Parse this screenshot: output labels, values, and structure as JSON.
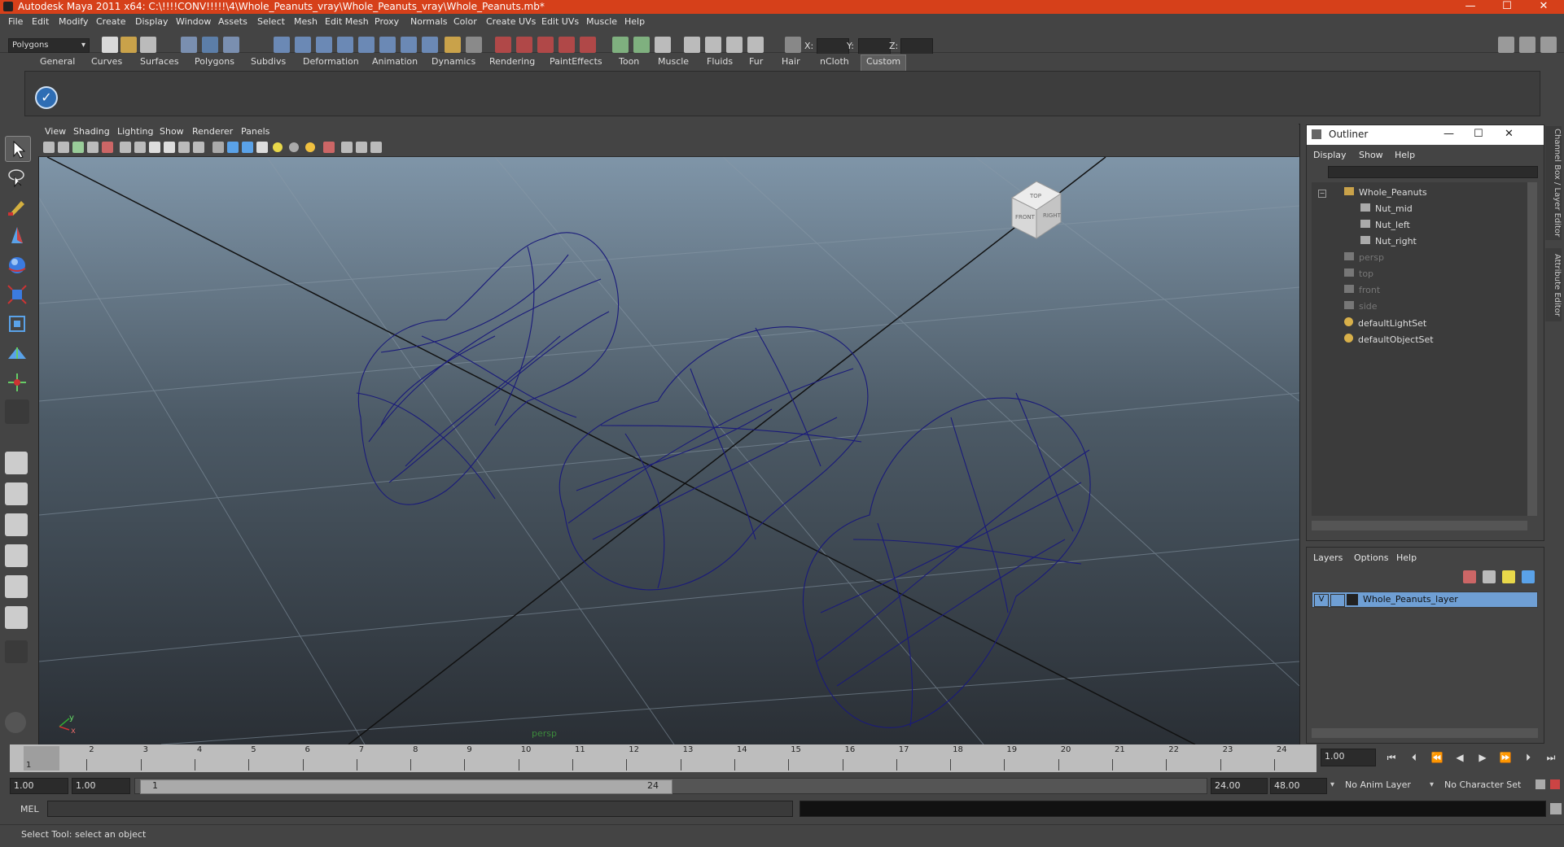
{
  "window": {
    "title": "Autodesk Maya 2011 x64: C:\\!!!!CONV!!!!!\\4\\Whole_Peanuts_vray\\Whole_Peanuts_vray\\Whole_Peanuts.mb*",
    "minimize": "—",
    "maximize": "☐",
    "close": "✕"
  },
  "menubar": [
    "File",
    "Edit",
    "Modify",
    "Create",
    "Display",
    "Window",
    "Assets",
    "Select",
    "Mesh",
    "Edit Mesh",
    "Proxy",
    "Normals",
    "Color",
    "Create UVs",
    "Edit UVs",
    "Muscle",
    "Help"
  ],
  "statusline": {
    "mode": "Polygons",
    "x_label": "X:",
    "y_label": "Y:",
    "z_label": "Z:"
  },
  "shelf_tabs": [
    "General",
    "Curves",
    "Surfaces",
    "Polygons",
    "Subdivs",
    "Deformation",
    "Animation",
    "Dynamics",
    "Rendering",
    "PaintEffects",
    "Toon",
    "Muscle",
    "Fluids",
    "Fur",
    "Hair",
    "nCloth",
    "Custom"
  ],
  "active_shelf": "Custom",
  "viewport": {
    "menu": [
      "View",
      "Shading",
      "Lighting",
      "Show",
      "Renderer",
      "Panels"
    ],
    "camera_label": "persp",
    "axis_y": "y",
    "axis_x": "x",
    "viewcube_labels": [
      "TOP",
      "FRONT",
      "RIGHT"
    ]
  },
  "outliner": {
    "title": "Outliner",
    "menu": [
      "Display",
      "Show",
      "Help"
    ],
    "items": [
      {
        "label": "Whole_Peanuts",
        "dim": false
      },
      {
        "label": "Nut_mid",
        "dim": false
      },
      {
        "label": "Nut_left",
        "dim": false
      },
      {
        "label": "Nut_right",
        "dim": false
      },
      {
        "label": "persp",
        "dim": true
      },
      {
        "label": "top",
        "dim": true
      },
      {
        "label": "front",
        "dim": true
      },
      {
        "label": "side",
        "dim": true
      },
      {
        "label": "defaultLightSet",
        "dim": false
      },
      {
        "label": "defaultObjectSet",
        "dim": false
      }
    ]
  },
  "layers": {
    "menu": [
      "Layers",
      "Options",
      "Help"
    ],
    "layer_visible": "V",
    "layer_name": "Whole_Peanuts_layer"
  },
  "side_tabs": [
    "Channel Box / Layer Editor",
    "Attribute Editor"
  ],
  "timeline": {
    "ticks": [
      "1",
      "2",
      "3",
      "4",
      "5",
      "6",
      "7",
      "8",
      "9",
      "10",
      "11",
      "12",
      "13",
      "14",
      "15",
      "16",
      "17",
      "18",
      "19",
      "20",
      "21",
      "22",
      "23",
      "24"
    ],
    "current_frame": "1",
    "current_time_field": "1.00"
  },
  "range": {
    "start": "1.00",
    "inner_start": "1.00",
    "slider_start": "1",
    "slider_end": "24",
    "end": "24.00",
    "max": "48.00",
    "anim_layer": "No Anim Layer",
    "character_set": "No Character Set"
  },
  "cmdline": {
    "label": "MEL"
  },
  "helpline": {
    "text": "Select Tool: select an object"
  },
  "colors": {
    "titlebar": "#d6401a",
    "wire": "#1a1a7a",
    "selected_layer": "#6f9fd4"
  }
}
